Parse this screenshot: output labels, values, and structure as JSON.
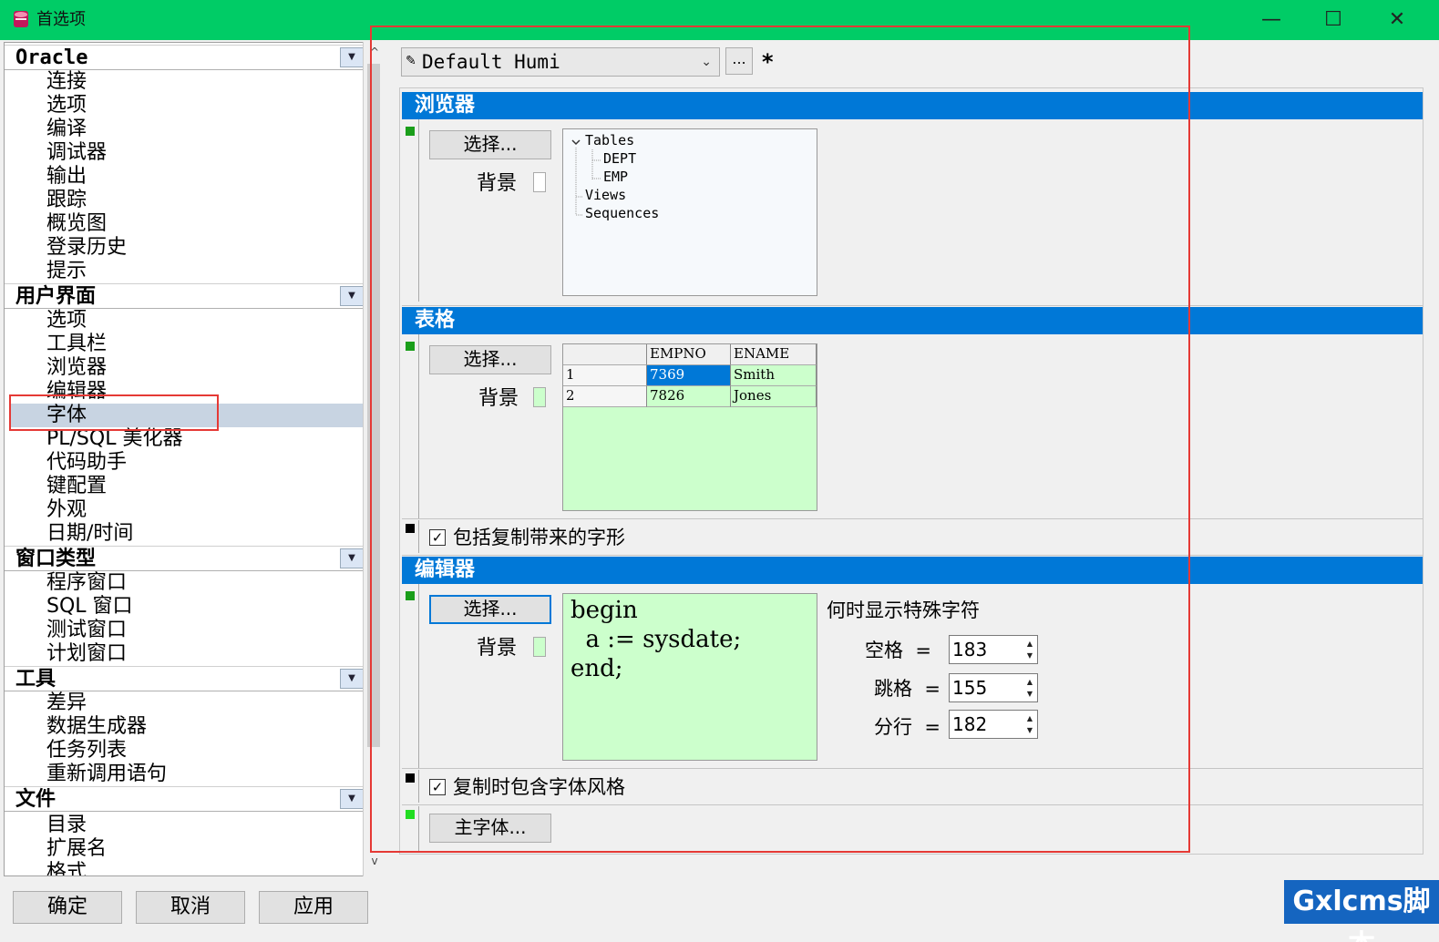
{
  "window": {
    "title": "首选项",
    "minimize": "—",
    "maximize": "☐",
    "close": "✕"
  },
  "tree": {
    "categories": [
      {
        "label": "Oracle",
        "items": [
          "连接",
          "选项",
          "编译",
          "调试器",
          "输出",
          "跟踪",
          "概览图",
          "登录历史",
          "提示"
        ]
      },
      {
        "label": "用户界面",
        "items": [
          "选项",
          "工具栏",
          "浏览器",
          "编辑器",
          "字体",
          "PL/SQL 美化器",
          "代码助手",
          "键配置",
          "外观",
          "日期/时间"
        ]
      },
      {
        "label": "窗口类型",
        "items": [
          "程序窗口",
          "SQL 窗口",
          "测试窗口",
          "计划窗口"
        ]
      },
      {
        "label": "工具",
        "items": [
          "差异",
          "数据生成器",
          "任务列表",
          "重新调用语句"
        ]
      },
      {
        "label": "文件",
        "items": [
          "目录",
          "扩展名",
          "格式"
        ]
      }
    ],
    "selected": "字体"
  },
  "preset": {
    "value": "Default Humi",
    "more": "...",
    "modified": "*"
  },
  "browser_section": {
    "title": "浏览器",
    "select_label": "选择...",
    "background_label": "背景",
    "preview": {
      "tables": "Tables",
      "dept": "DEPT",
      "emp": "EMP",
      "views": "Views",
      "sequences": "Sequences"
    }
  },
  "grid_section": {
    "title": "表格",
    "select_label": "选择...",
    "background_label": "背景",
    "columns": [
      "",
      "EMPNO",
      "ENAME"
    ],
    "rows": [
      [
        "1",
        "7369",
        "Smith"
      ],
      [
        "2",
        "7826",
        "Jones"
      ]
    ],
    "copy_glyphs_label": "包括复制带来的字形"
  },
  "editor_section": {
    "title": "编辑器",
    "select_label": "选择...",
    "background_label": "背景",
    "code": [
      "begin",
      "  a := sysdate;",
      "end;"
    ],
    "special_chars_label": "何时显示特殊字符",
    "space_label": "空格  =",
    "space_value": "183",
    "tab_label": "跳格  =",
    "tab_value": "155",
    "newline_label": "分行  =",
    "newline_value": "182",
    "copy_font_style_label": "复制时包含字体风格"
  },
  "main_font": {
    "button_label": "主字体..."
  },
  "buttons": {
    "ok": "确定",
    "cancel": "取消",
    "apply": "应用"
  },
  "watermark": "Gxlcms脚本",
  "colors": {
    "titlebar": "#00cc66",
    "section_header": "#0078d7",
    "preview_bg": "#ccffcc",
    "selection_highlight": "#c8d4e2",
    "annotation_red": "#e53935"
  }
}
